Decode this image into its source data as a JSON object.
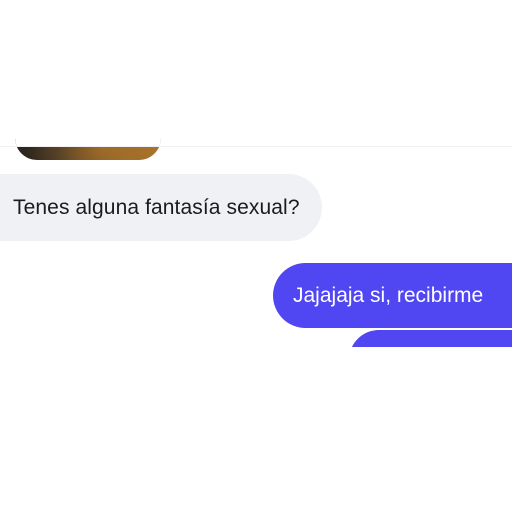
{
  "conversation": {
    "messages": [
      {
        "direction": "incoming",
        "type": "photo",
        "text": ""
      },
      {
        "direction": "incoming",
        "type": "text",
        "text": "Tenes alguna fantasía sexual?"
      },
      {
        "direction": "outgoing",
        "type": "text",
        "text": "Jajajaja si, recibirme"
      },
      {
        "direction": "outgoing",
        "type": "text",
        "text": ""
      }
    ]
  },
  "colors": {
    "background": "#ffffff",
    "incoming_bubble": "#f0f1f4",
    "incoming_text": "#1b1b1d",
    "outgoing_bubble": "#5046f2",
    "outgoing_text": "#ffffff"
  }
}
